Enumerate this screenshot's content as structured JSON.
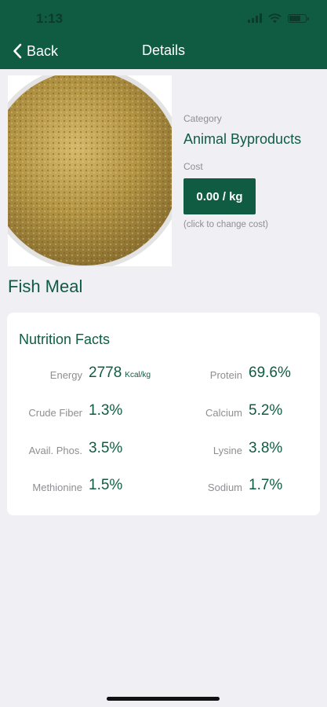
{
  "status_bar": {
    "time": "1:13"
  },
  "nav": {
    "back_label": "Back",
    "title": "Details"
  },
  "food": {
    "name": "Fish Meal",
    "category_label": "Category",
    "category": "Animal Byproducts",
    "cost_label": "Cost",
    "cost_button": "0.00 / kg",
    "cost_hint": "(click to change cost)"
  },
  "nutrition": {
    "title": "Nutrition Facts",
    "energy_label": "Energy",
    "energy_value": "2778",
    "energy_unit": "Kcal/kg",
    "protein_label": "Protein",
    "protein_value": "69.6%",
    "crude_fiber_label": "Crude Fiber",
    "crude_fiber_value": "1.3%",
    "calcium_label": "Calcium",
    "calcium_value": "5.2%",
    "avail_phos_label": "Avail. Phos.",
    "avail_phos_value": "3.5%",
    "lysine_label": "Lysine",
    "lysine_value": "3.8%",
    "methionine_label": "Methionine",
    "methionine_value": "1.5%",
    "sodium_label": "Sodium",
    "sodium_value": "1.7%"
  },
  "colors": {
    "header": "#0f5c43",
    "accent": "#0f5c43",
    "background": "#efeff4",
    "muted_text": "#8e8e93"
  },
  "icons": [
    "chevron-left-icon",
    "signal-icon",
    "wifi-icon",
    "battery-icon"
  ]
}
